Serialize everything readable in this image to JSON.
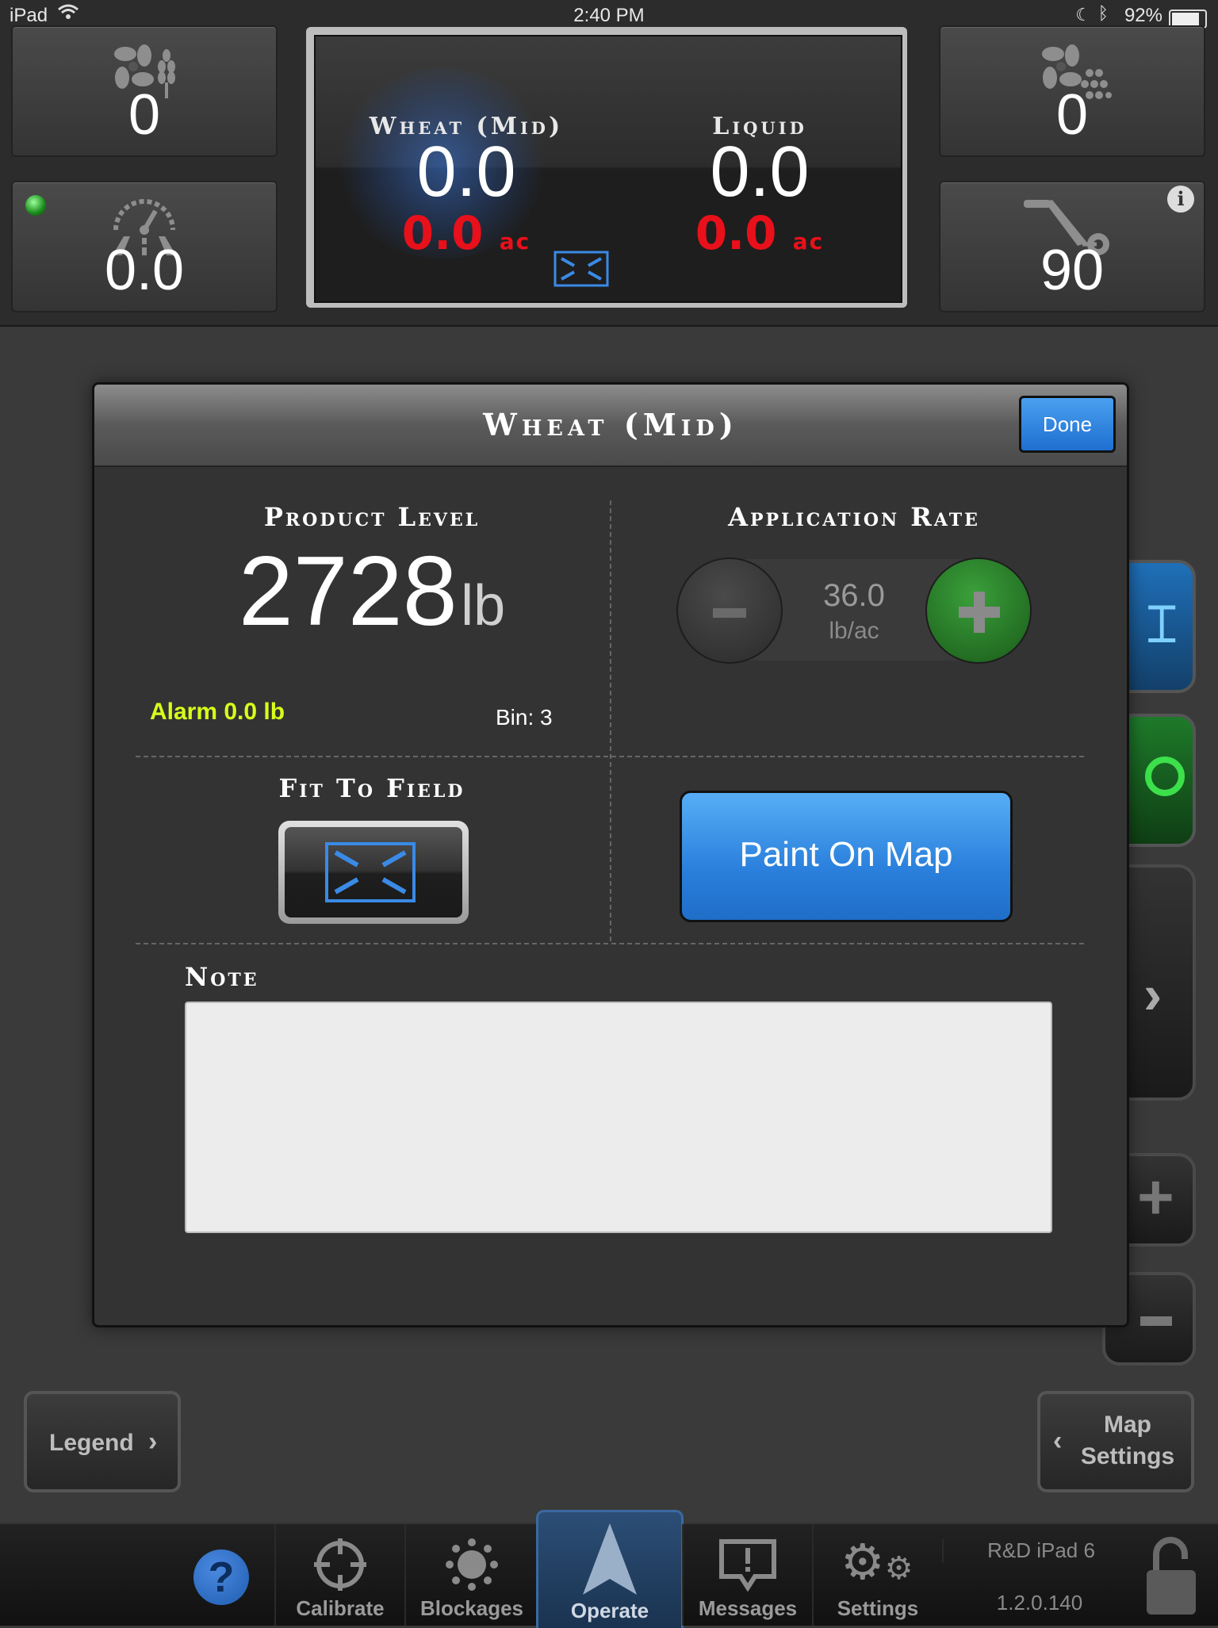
{
  "status_bar": {
    "device": "iPad",
    "time": "2:40 PM",
    "battery": "92%"
  },
  "top_tiles": {
    "seed_fan": "0",
    "fertilizer_fan": "0",
    "speed": "0.0",
    "implement": "90"
  },
  "center_display": {
    "products": [
      {
        "name": "Wheat (Mid)",
        "value": "0.0",
        "area": "0.0",
        "area_unit": "ac"
      },
      {
        "name": "Liquid",
        "value": "0.0",
        "area": "0.0",
        "area_unit": "ac"
      }
    ]
  },
  "modal": {
    "title": "Wheat (Mid)",
    "done_label": "Done",
    "product_level": {
      "label": "Product Level",
      "value": "2728",
      "unit": "lb",
      "alarm": "Alarm 0.0 lb",
      "bin": "Bin: 3"
    },
    "application_rate": {
      "label": "Application Rate",
      "value": "36.0",
      "unit": "lb/ac"
    },
    "fit_to_field": {
      "label": "Fit To Field"
    },
    "paint_on_map_label": "Paint On Map",
    "note": {
      "label": "Note",
      "value": ""
    }
  },
  "map_controls": {
    "legend_label": "Legend",
    "map_settings_line1": "Map",
    "map_settings_line2": "Settings"
  },
  "tab_bar": {
    "tabs": [
      {
        "id": "calibrate",
        "label": "Calibrate"
      },
      {
        "id": "blockages",
        "label": "Blockages"
      },
      {
        "id": "operate",
        "label": "Operate",
        "active": true
      },
      {
        "id": "messages",
        "label": "Messages"
      },
      {
        "id": "settings",
        "label": "Settings"
      }
    ],
    "device_name": "R&D iPad 6",
    "version": "1.2.0.140"
  },
  "colors": {
    "accent_blue": "#2a80dc",
    "alarm_yellow": "#d8ff1a",
    "area_red": "#e8101a",
    "plus_green": "#2e8a2e"
  }
}
